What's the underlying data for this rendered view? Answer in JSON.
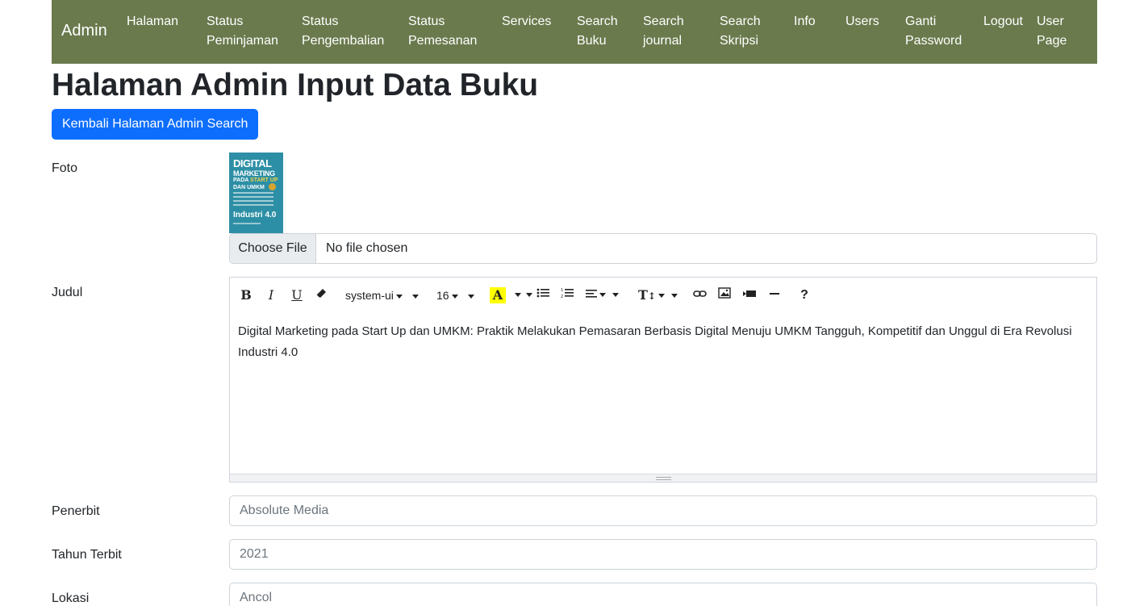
{
  "navbar": {
    "brand": "Admin",
    "items": [
      {
        "label": "Halaman"
      },
      {
        "label": "Status\nPeminjaman"
      },
      {
        "label": "Status\nPengembalian"
      },
      {
        "label": "Status\nPemesanan"
      },
      {
        "label": "Services"
      },
      {
        "label": "Search\nBuku"
      },
      {
        "label": "Search\njournal"
      },
      {
        "label": "Search\nSkripsi"
      },
      {
        "label": "Info"
      },
      {
        "label": "Users"
      },
      {
        "label": "Ganti\nPassword"
      },
      {
        "label": "Logout"
      },
      {
        "label": "User\nPage"
      }
    ],
    "bg_color": "#6a7a4d"
  },
  "page": {
    "title": "Halaman Admin Input Data Buku",
    "back_button": "Kembali Halaman Admin Search"
  },
  "form": {
    "foto": {
      "label": "Foto",
      "cover": {
        "line1": "DIGITAL",
        "line2": "MARKETING",
        "line3a": "PADA ",
        "line3b": "START UP",
        "line4": "DAN UMKM",
        "line5": "Industri 4.0"
      },
      "file_button": "Choose File",
      "file_status": "No file chosen"
    },
    "judul": {
      "label": "Judul",
      "toolbar": {
        "font_family": "system-ui",
        "font_size": "16",
        "bold": "B",
        "italic": "I",
        "underline": "U",
        "text_color": "A",
        "font_height": "T",
        "help": "?"
      },
      "content": "Digital Marketing pada Start Up dan UMKM: Praktik Melakukan Pemasaran Berbasis Digital Menuju UMKM Tangguh, Kompetitif dan Unggul di Era Revolusi Industri 4.0"
    },
    "penerbit": {
      "label": "Penerbit",
      "placeholder": "Absolute Media"
    },
    "tahun_terbit": {
      "label": "Tahun Terbit",
      "placeholder": "2021"
    },
    "lokasi": {
      "label": "Lokasi",
      "placeholder": "Ancol"
    }
  },
  "colors": {
    "primary": "#0d6efd",
    "highlight": "#ffff00"
  }
}
